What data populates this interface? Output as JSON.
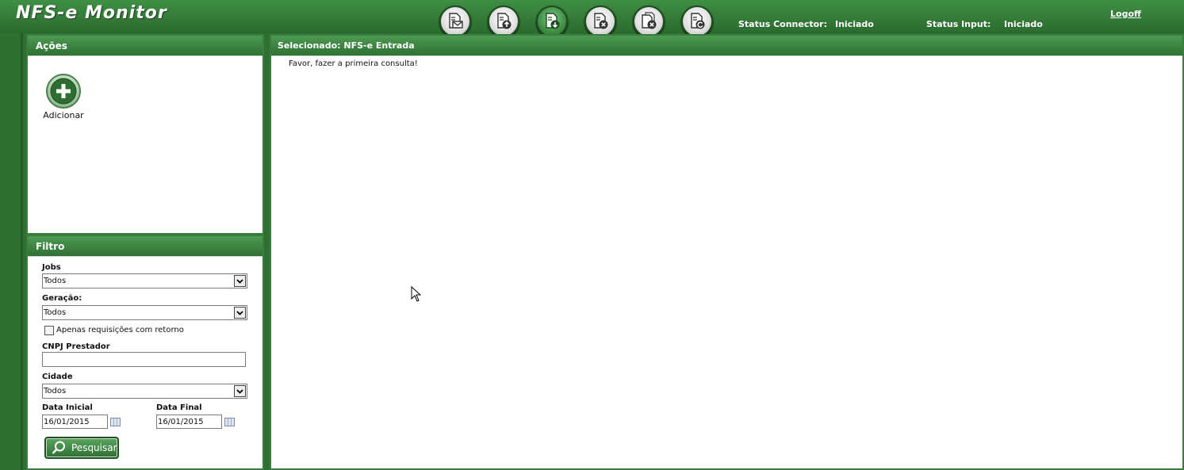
{
  "header": {
    "app_title": "NFS-e Monitor",
    "toolbar": [
      {
        "name": "send-email-icon",
        "active": false
      },
      {
        "name": "upload-doc-icon",
        "active": false
      },
      {
        "name": "download-doc-icon",
        "active": true
      },
      {
        "name": "cancel-doc-icon",
        "active": false
      },
      {
        "name": "cancel-batch-icon",
        "active": false
      },
      {
        "name": "refresh-doc-icon",
        "active": false
      }
    ],
    "status_connector_label": "Status Connector:",
    "status_connector_value": "Iniciado",
    "status_input_label": "Status Input:",
    "status_input_value": "Iniciado",
    "logoff_label": "Logoff"
  },
  "actions_panel": {
    "title": "Ações",
    "add_label": "Adicionar"
  },
  "filter_panel": {
    "title": "Filtro",
    "jobs_label": "Jobs",
    "jobs_value": "Todos",
    "geracao_label": "Geração:",
    "geracao_value": "Todos",
    "only_with_return_label": "Apenas requisições com retorno",
    "only_with_return_checked": false,
    "cnpj_label": "CNPJ Prestador",
    "cnpj_value": "",
    "cidade_label": "Cidade",
    "cidade_value": "Todos",
    "data_inicial_label": "Data Inicial",
    "data_inicial_value": "16/01/2015",
    "data_final_label": "Data Final",
    "data_final_value": "16/01/2015",
    "search_label": "Pesquisar"
  },
  "content_panel": {
    "title": "Selecionado: NFS-e Entrada",
    "message": "Favor, fazer a primeira consulta!"
  },
  "colors": {
    "brand_green": "#2e6f32",
    "header_green": "#3f8f44"
  }
}
